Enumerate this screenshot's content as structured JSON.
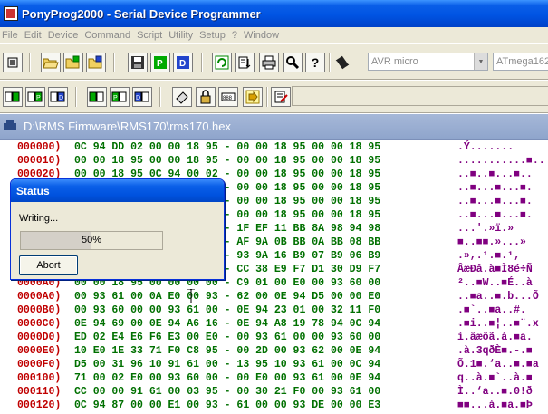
{
  "window": {
    "title": "PonyProg2000 - Serial Device Programmer"
  },
  "menu": [
    "File",
    "Edit",
    "Device",
    "Command",
    "Script",
    "Utility",
    "Setup",
    "?",
    "Window"
  ],
  "toolbar": {
    "device_family": "AVR micro",
    "device_type": "ATmega162"
  },
  "document": {
    "path": "D:\\RMS Firmware\\RMS170\\rms170.hex"
  },
  "hex": {
    "rows": [
      {
        "addr": "000000)",
        "bytes": "0C 94 DD 02 00 00 18 95 - 00 00 18 95 00 00 18 95",
        "ascii": ".Ý......."
      },
      {
        "addr": "000010)",
        "bytes": "00 00 18 95 00 00 18 95 - 00 00 18 95 00 00 18 95",
        "ascii": "...........■.."
      },
      {
        "addr": "000020)",
        "bytes": "00 00 18 95 0C 94 00 02 - 00 00 18 95 00 00 18 95",
        "ascii": "..■..■...■.."
      },
      {
        "addr": "000030)",
        "bytes": "00 00 18 95 00 00 18 95 - 00 00 18 95 00 00 18 95",
        "ascii": "..■...■...■."
      },
      {
        "addr": "000040)",
        "bytes": "00 00 18 95 00 00 18 95 - 00 00 18 95 00 00 18 95",
        "ascii": "..■...■...■."
      },
      {
        "addr": "000050)",
        "bytes": "00 00 18 95 00 00 18 95 - 00 00 18 95 00 00 18 95",
        "ascii": "..■...■...■."
      },
      {
        "addr": "000060)",
        "bytes": "00 00 18 95 00 00 00 BB - 1F EF 11 BB 8A 98 94 98",
        "ascii": "...'.»ï.»"
      },
      {
        "addr": "000070)",
        "bytes": "00 00 18 95 00 00 00 BB - AF 9A 0B BB 0A BB 08 BB",
        "ascii": "■..■■.»...»"
      },
      {
        "addr": "000080)",
        "bytes": "00 00 18 95 00 00 00 BB - 93 9A 16 B9 07 B9 06 B9",
        "ascii": ".»,.¹.■.¹,"
      },
      {
        "addr": "000090)",
        "bytes": "00 00 18 95 00 00 00 93 - CC 38 E9 F7 D1 30 D9 F7",
        "ascii": "ÂæÐå.à■Ì8é÷Ñ"
      },
      {
        "addr": "0000A0)",
        "bytes": "00 00 18 95 00 00 00 00 - C9 01 00 E0 00 93 60 00",
        "ascii": "²..■W..■É..à"
      },
      {
        "addr": "0000A0)",
        "bytes": "00 93 61 00 0A E0 00 93 - 62 00 0E 94 D5 00 00 E0",
        "ascii": "..■a..■.b...Õ"
      },
      {
        "addr": "0000B0)",
        "bytes": "00 93 60 00 00 93 61 00 - 0E 94 23 01 00 32 11 F0",
        "ascii": ".■`..■a..#."
      },
      {
        "addr": "0000C0)",
        "bytes": "0E 94 69 00 0E 94 A6 16 - 0E 94 A8 19 78 94 0C 94",
        "ascii": ".■i..■¦..■¨.x"
      },
      {
        "addr": "0000D0)",
        "bytes": "ED 02 E4 E6 F6 E3 00 E0 - 00 93 61 00 00 93 60 00",
        "ascii": "í.äæöã.à.■a."
      },
      {
        "addr": "0000E0)",
        "bytes": "10 E0 1E 33 71 F0 C8 95 - 00 2D 00 93 62 00 0E 94",
        "ascii": ".à.3qðÈ■.-.■"
      },
      {
        "addr": "0000F0)",
        "bytes": "D5 00 31 96 10 91 61 00 - 13 95 10 93 61 00 0C 94",
        "ascii": "Õ.1■.‘a..■.■a"
      },
      {
        "addr": "000100)",
        "bytes": "71 00 02 E0 00 93 60 00 - 00 E0 00 93 61 00 0E 94",
        "ascii": "q..à.■`..à.■"
      },
      {
        "addr": "000110)",
        "bytes": "CC 00 00 91 61 00 03 95 - 00 30 21 F0 00 93 61 00",
        "ascii": "Ì..‘a..■.0!ð"
      },
      {
        "addr": "000120)",
        "bytes": "0C 94 87 00 00 E1 00 93 - 61 00 00 93 DE 00 00 E3",
        "ascii": "■■...á.■a.■Þ"
      }
    ]
  },
  "status_dialog": {
    "title": "Status",
    "message": "Writing...",
    "progress_percent": 50,
    "progress_label": "50%",
    "abort_label": "Abort"
  },
  "colors": {
    "address": "#c00000",
    "hex_bytes": "#007000",
    "ascii": "#800080"
  }
}
